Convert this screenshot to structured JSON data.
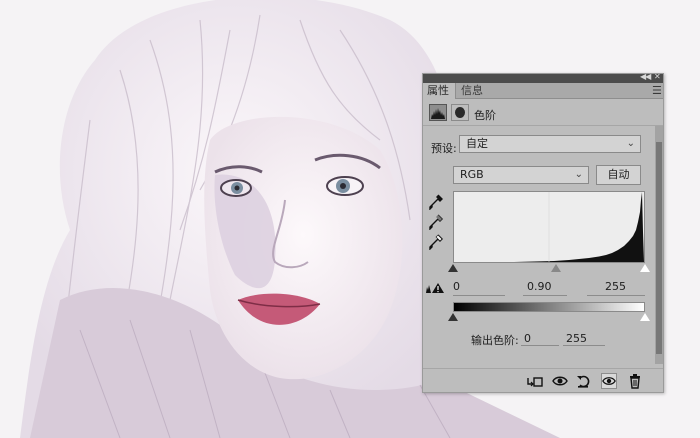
{
  "panel": {
    "tabs": [
      {
        "label": "属性",
        "active": true
      },
      {
        "label": "信息",
        "active": false
      }
    ],
    "adjustment_label": "色阶",
    "preset": {
      "label": "预设:",
      "value": "自定"
    },
    "channel": {
      "value": "RGB"
    },
    "auto_button": "自动",
    "input_levels": {
      "black": "0",
      "gamma": "0.90",
      "white": "255"
    },
    "output_levels": {
      "label": "输出色阶:",
      "black": "0",
      "white": "255"
    }
  },
  "icons": {
    "titlebar": [
      "collapse-icon",
      "close-icon"
    ],
    "tabbar": [
      "panel-menu-icon"
    ],
    "header": [
      "levels-histogram-icon",
      "layer-mask-icon"
    ],
    "tools": [
      "black-point-eyedropper-icon",
      "gray-point-eyedropper-icon",
      "white-point-eyedropper-icon",
      "clipping-warning-icon"
    ],
    "footer": [
      "clip-to-layer-icon",
      "view-previous-state-icon",
      "reset-icon",
      "toggle-visibility-icon",
      "delete-icon"
    ]
  },
  "colors": {
    "panel_bg": "#bdbdbd",
    "titlebar": "#4c4c4c",
    "histogram_bg": "#ededed",
    "histogram_fill": "#111111"
  }
}
